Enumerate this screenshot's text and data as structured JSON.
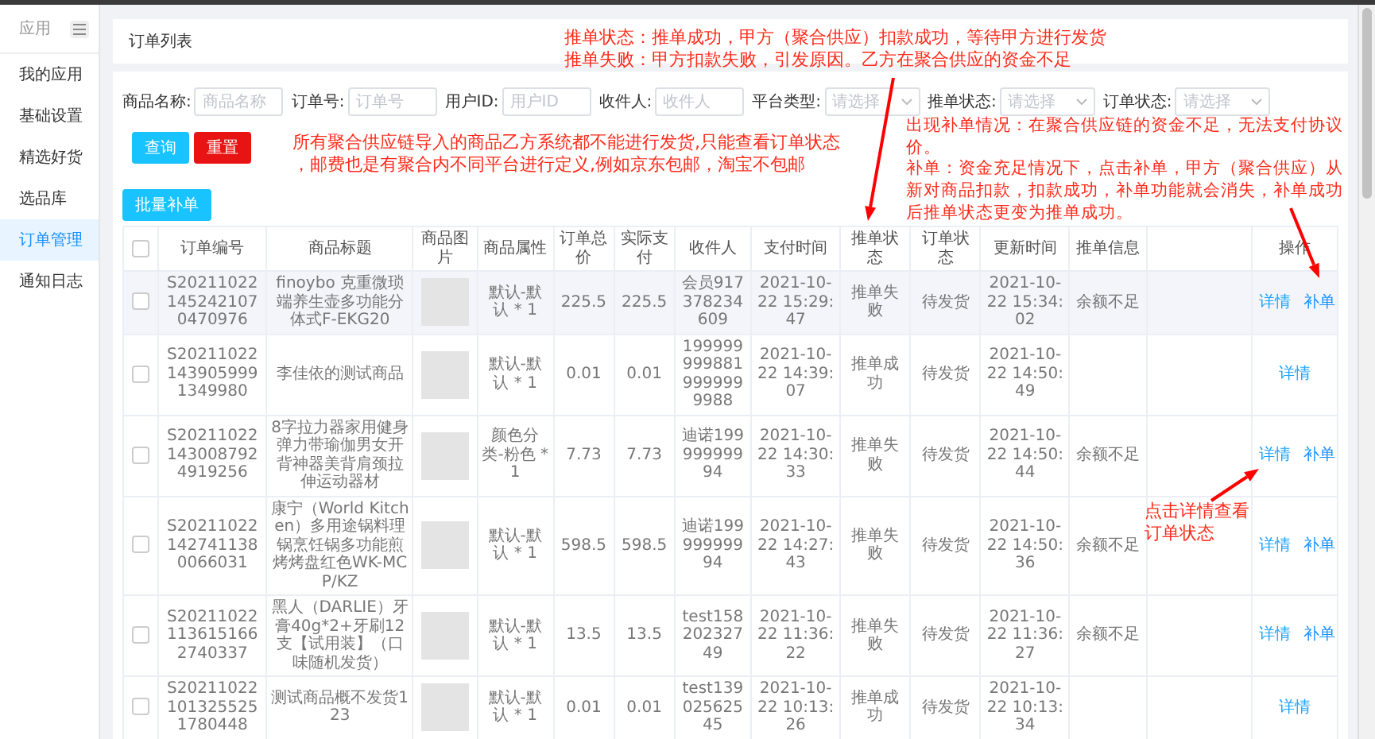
{
  "sidebar": {
    "title": "应用",
    "items": [
      {
        "label": "我的应用",
        "selected": false
      },
      {
        "label": "基础设置",
        "selected": false
      },
      {
        "label": "精选好货",
        "selected": false
      },
      {
        "label": "选品库",
        "selected": false
      },
      {
        "label": "订单管理",
        "selected": true
      },
      {
        "label": "通知日志",
        "selected": false
      }
    ]
  },
  "page_header": {
    "title": "订单列表"
  },
  "filters": [
    {
      "kind": "input",
      "label": "商品名称:",
      "placeholder": "商品名称"
    },
    {
      "kind": "input",
      "label": "订单号:",
      "placeholder": "订单号"
    },
    {
      "kind": "input",
      "label": "用户ID:",
      "placeholder": "用户ID"
    },
    {
      "kind": "input",
      "label": "收件人:",
      "placeholder": "收件人"
    },
    {
      "kind": "select",
      "label": "平台类型:",
      "placeholder": "请选择"
    },
    {
      "kind": "select",
      "label": "推单状态:",
      "placeholder": "请选择"
    },
    {
      "kind": "select",
      "label": "订单状态:",
      "placeholder": "请选择"
    }
  ],
  "buttons": [
    {
      "kind": "primary",
      "label": "查询"
    },
    {
      "kind": "danger",
      "label": "重置"
    }
  ],
  "batch_button": "批量补单",
  "table": {
    "header_checked": false,
    "columns": [
      "订单编号",
      "商品标题",
      "商品图片",
      "商品属性",
      "订单总价",
      "实际支付",
      "收件人",
      "支付时间",
      "推单状态",
      "订单状态",
      "更新时间",
      "推单信息",
      "操作"
    ],
    "rows": [
      {
        "checked": false,
        "highlighted": true,
        "order_no": "S202110221452421070470976",
        "title": "finoybo 克重微琐端养生壶多功能分体式F-EKG20",
        "attrs": "默认-默认 * 1",
        "total": "225.5",
        "paid": "225.5",
        "receiver": "会员917378234609",
        "pay_time": "2021-10-22 15:29:47",
        "push_status": "推单失败",
        "order_status": "待发货",
        "update_time": "2021-10-22 15:34:02",
        "push_info": "余额不足",
        "actions": [
          {
            "kind": "detail",
            "label": "详情"
          },
          {
            "kind": "reissue",
            "label": "补单"
          }
        ]
      },
      {
        "checked": false,
        "highlighted": false,
        "order_no": "S202110221439059991349980",
        "title": "李佳依的测试商品",
        "attrs": "默认-默认 * 1",
        "total": "0.01",
        "paid": "0.01",
        "receiver": "1999999998819999999988",
        "pay_time": "2021-10-22 14:39:07",
        "push_status": "推单成功",
        "order_status": "待发货",
        "update_time": "2021-10-22 14:50:49",
        "actions": [
          {
            "kind": "detail",
            "label": "详情"
          }
        ]
      },
      {
        "checked": false,
        "highlighted": false,
        "order_no": "S202110221430087924919256",
        "title": "8字拉力器家用健身弹力带瑜伽男女开背神器美背肩颈拉伸运动器材",
        "attrs": "颜色分类-粉色 * 1",
        "total": "7.73",
        "paid": "7.73",
        "receiver": "迪诺19999999994",
        "pay_time": "2021-10-22 14:30:33",
        "push_status": "推单失败",
        "order_status": "待发货",
        "update_time": "2021-10-22 14:50:44",
        "push_info": "余额不足",
        "actions": [
          {
            "kind": "detail",
            "label": "详情"
          },
          {
            "kind": "reissue",
            "label": "补单"
          }
        ]
      },
      {
        "checked": false,
        "highlighted": false,
        "order_no": "S202110221427411380066031",
        "title": "康宁（World Kitchen）多用途锅料理锅烹饪锅多功能煎烤烤盘红色WK-MCP/KZ",
        "attrs": "默认-默认 * 1",
        "total": "598.5",
        "paid": "598.5",
        "receiver": "迪诺19999999994",
        "pay_time": "2021-10-22 14:27:43",
        "push_status": "推单失败",
        "order_status": "待发货",
        "update_time": "2021-10-22 14:50:36",
        "push_info": "余额不足",
        "actions": [
          {
            "kind": "detail",
            "label": "详情"
          },
          {
            "kind": "reissue",
            "label": "补单"
          }
        ]
      },
      {
        "checked": false,
        "highlighted": false,
        "order_no": "S202110221136151662740337",
        "title": "黑人（DARLIE）牙膏40g*2+牙刷12支【试用装】（口味随机发货）",
        "attrs": "默认-默认 * 1",
        "total": "13.5",
        "paid": "13.5",
        "receiver": "test15820232749",
        "pay_time": "2021-10-22 11:36:22",
        "push_status": "推单失败",
        "order_status": "待发货",
        "update_time": "2021-10-22 11:36:27",
        "push_info": "余额不足",
        "actions": [
          {
            "kind": "detail",
            "label": "详情"
          },
          {
            "kind": "reissue",
            "label": "补单"
          }
        ]
      },
      {
        "checked": false,
        "highlighted": false,
        "order_no": "S202110221013255251780448",
        "title": "测试商品概不发货123",
        "attrs": "默认-默认 * 1",
        "total": "0.01",
        "paid": "0.01",
        "receiver": "test13902562545",
        "pay_time": "2021-10-22 10:13:26",
        "push_status": "推单成功",
        "order_status": "待发货",
        "update_time": "2021-10-22 10:13:34",
        "actions": [
          {
            "kind": "detail",
            "label": "详情"
          }
        ]
      }
    ]
  },
  "annotations": [
    {
      "lines": [
        "推单状态：推单成功，甲方（聚合供应）扣款成功，等待甲方进行发货",
        "推单失败：甲方扣款失败，引发原因。乙方在聚合供应的资金不足"
      ]
    },
    {
      "lines": [
        "所有聚合供应链导入的商品乙方系统都不能进行发货,只能查看订单状态",
        "，邮费也是有聚合内不同平台进行定义,例如京东包邮，淘宝不包邮"
      ]
    },
    {
      "lines": [
        "出现补单情况：在聚合供应链的资金不足，无法支付协议价。",
        "补单：资金充足情况下，点击补单，甲方（聚合供应）从新对商品扣款，扣款成功，补单功能就会消失，补单成功后推单状态更变为推单成功。"
      ]
    },
    {
      "lines": [
        "点击详情查看订单状态"
      ]
    }
  ]
}
